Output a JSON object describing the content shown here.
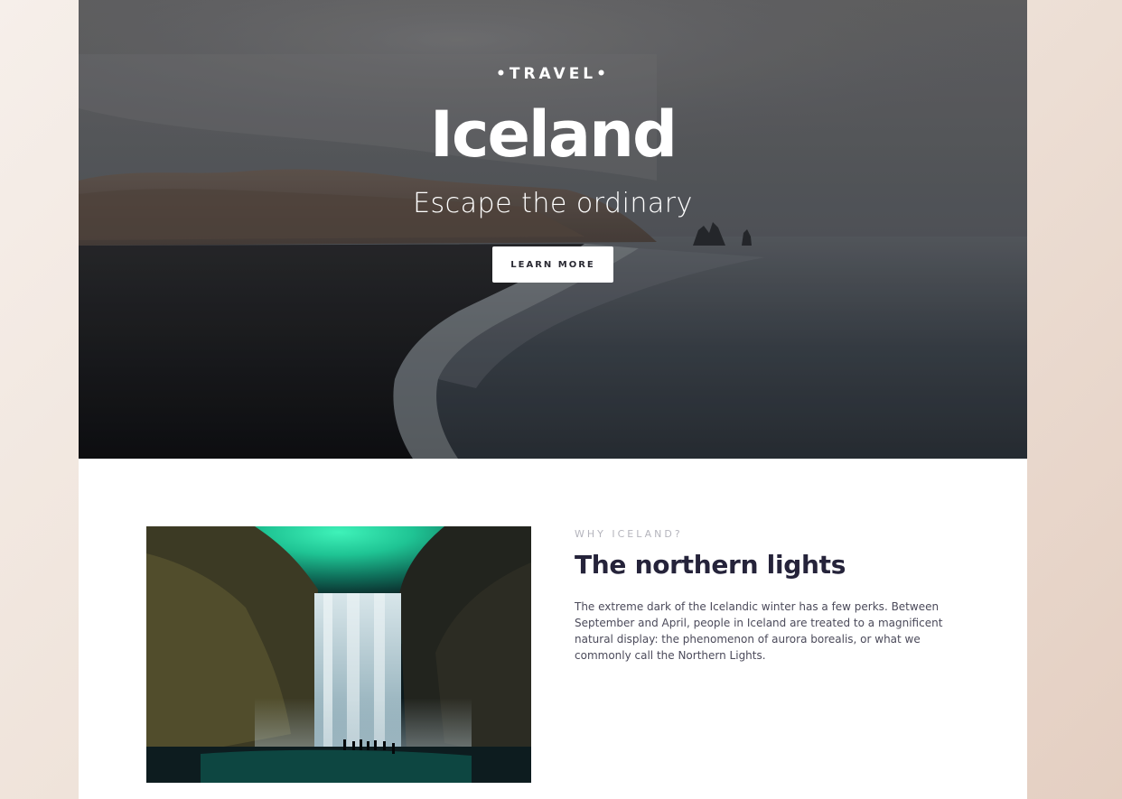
{
  "hero": {
    "eyebrow": "•TRAVEL•",
    "title": "Iceland",
    "subtitle": "Escape the ordinary",
    "button_label": "LEARN MORE"
  },
  "feature": {
    "kicker": "WHY ICELAND?",
    "title": "The northern lights",
    "body": "The extreme dark of the Icelandic winter has a few perks. Between September and April, people in Iceland are treated to a magnificent natural display: the phenomenon of aurora borealis, or what we commonly call the Northern Lights."
  },
  "colors": {
    "page_background": "#efe3da",
    "card_background": "#ffffff",
    "heading_dark": "#25233a",
    "body_text": "#4b4a5a",
    "kicker_gray": "#b5b5bd",
    "button_background": "#ffffff",
    "button_text": "#2a2a33"
  }
}
